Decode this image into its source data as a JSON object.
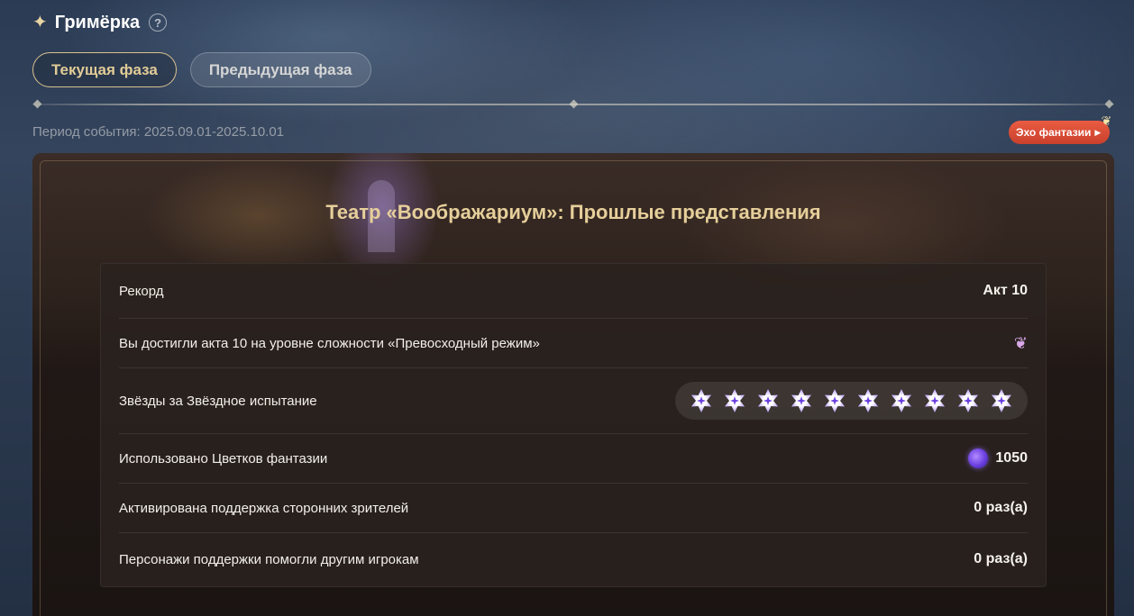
{
  "header": {
    "title": "Гримёрка",
    "spark_icon": "✦",
    "help_icon": "?"
  },
  "tabs": [
    {
      "label": "Текущая фаза",
      "active": true
    },
    {
      "label": "Предыдущая фаза",
      "active": false
    }
  ],
  "period": "Период события: 2025.09.01-2025.10.01",
  "badge": {
    "label": "Эхо фантазии",
    "arrow": "▶",
    "moth": "❦"
  },
  "panel": {
    "title": "Театр «Воображариум»: Прошлые представления",
    "rows": [
      {
        "label": "Рекорд",
        "value": "Акт 10"
      },
      {
        "label": "Вы достигли акта 10 на уровне сложности «Превосходный режим»",
        "icon": "moth-icon",
        "icon_glyph": "❦"
      },
      {
        "label": "Звёзды за Звёздное испытание",
        "stars": 10
      },
      {
        "label": "Использовано Цветков фантазии",
        "icon": "flower-icon",
        "value": "1050"
      },
      {
        "label": "Активирована поддержка сторонних зрителей",
        "value": "0 раз(а)"
      },
      {
        "label": "Персонажи поддержки помогли другим игрокам",
        "value": "0 раз(а)"
      }
    ]
  },
  "colors": {
    "accent_gold": "#e6cf9a",
    "badge_red": "#e2533b",
    "star_purple": "#6a3ee0"
  }
}
